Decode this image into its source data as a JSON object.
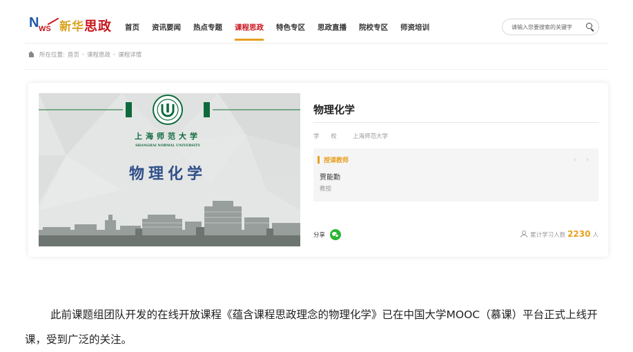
{
  "brand": {
    "logo_mark": "NEWS",
    "logo_text_1": "新华",
    "logo_text_2": "思政"
  },
  "nav": {
    "items": [
      {
        "label": "首页",
        "active": false
      },
      {
        "label": "资讯要闻",
        "active": false
      },
      {
        "label": "热点专题",
        "active": false
      },
      {
        "label": "课程思政",
        "active": true
      },
      {
        "label": "特色专区",
        "active": false
      },
      {
        "label": "思政直播",
        "active": false
      },
      {
        "label": "院校专区",
        "active": false
      },
      {
        "label": "师资培训",
        "active": false
      }
    ],
    "accent_color": "#e8a020",
    "active_text_color": "#c8161d"
  },
  "search": {
    "placeholder": "请输入您要搜索的关键字",
    "icon": "search-icon"
  },
  "breadcrumb": {
    "icon": "home-icon",
    "prefix": "所在位置:",
    "items": [
      "首页",
      "课程思政",
      "课程详情"
    ],
    "separator": "-"
  },
  "course": {
    "cover": {
      "university_cn": "上海师范大学",
      "university_en": "SHANGHAI NORMAL UNIVERSITY",
      "course_name": "物理化学",
      "icon": "university-seal-icon"
    },
    "title": "物理化学",
    "school_label": "学 校",
    "school_value": "上海师范大学",
    "teacher_section_label": "授课教师",
    "teacher_name": "贾能勤",
    "teacher_title": "教授",
    "prev_icon": "chevron-left-icon",
    "next_icon": "chevron-right-icon",
    "share_label": "分享",
    "share_icon": "wechat-icon",
    "learners_label": "累计学习人数",
    "learners_count": "2230",
    "learners_unit": "人",
    "learners_icon": "user-icon"
  },
  "article": {
    "paragraph": "此前课题组团队开发的在线开放课程《蕴含课程思政理念的物理化学》已在中国大学MOOC（慕课）平台正式上线开课，受到广泛的关注。"
  }
}
